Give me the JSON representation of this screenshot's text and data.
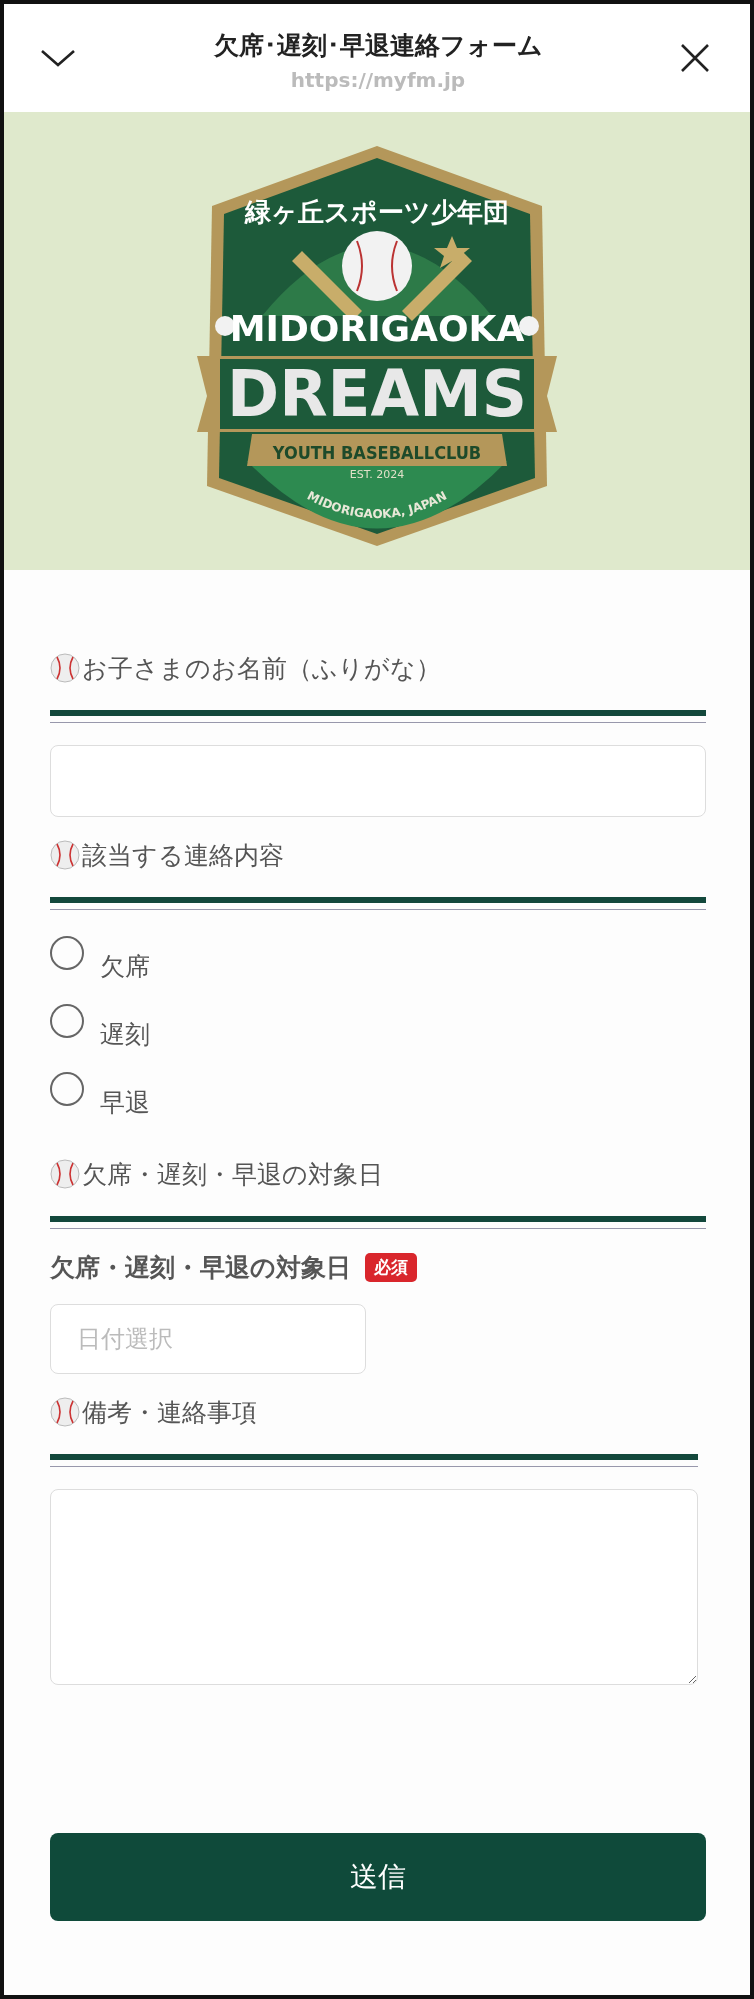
{
  "header": {
    "title": "欠席･遅刻･早退連絡フォーム",
    "url": "https://myfm.jp"
  },
  "logo": {
    "kanji": "緑ヶ丘スポーツ少年団",
    "line1": "MIDORIGAOKA",
    "line2": "DREAMS",
    "banner": "YOUTH BASEBALLCLUB",
    "est": "EST. 2024",
    "place": "MIDORIGAOKA, JAPAN"
  },
  "sections": [
    {
      "kind": "text",
      "heading": "お子さまのお名前（ふりがな）"
    },
    {
      "kind": "radio",
      "heading": "該当する連絡内容",
      "options": [
        {
          "label": "欠席",
          "selected": false
        },
        {
          "label": "遅刻",
          "selected": false
        },
        {
          "label": "早退",
          "selected": false
        }
      ]
    },
    {
      "kind": "date",
      "heading": "欠席・遅刻・早退の対象日",
      "field_label": "欠席・遅刻・早退の対象日",
      "required_badge": "必須",
      "placeholder": "日付選択"
    },
    {
      "kind": "textarea",
      "heading": "備考・連絡事項"
    }
  ],
  "submit": "送信"
}
